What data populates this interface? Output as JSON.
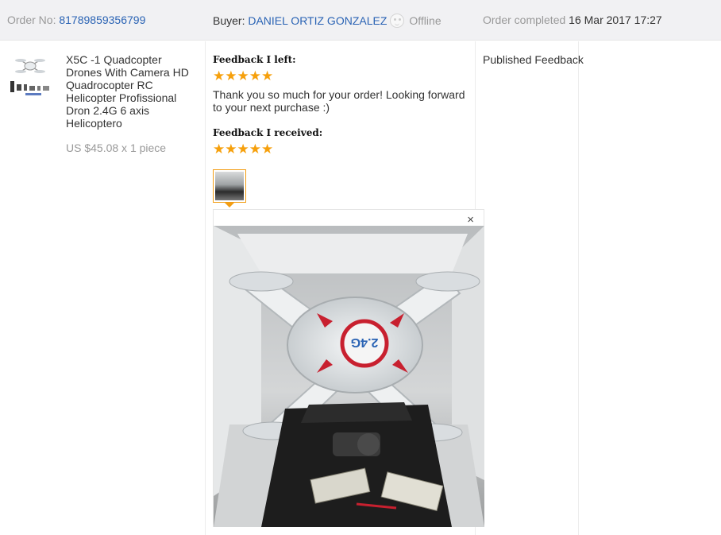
{
  "header": {
    "order_label": "Order No:",
    "order_number": "81789859356799",
    "buyer_label": "Buyer:",
    "buyer_name": "DANIEL ORTIZ GONZALEZ",
    "buyer_status": "Offline",
    "completed_label": "Order completed",
    "completed_date": "16 Mar 2017 17:27"
  },
  "product": {
    "title": "X5C -1 Quadcopter Drones With Camera HD Quadrocopter RC Helicopter Profissional Dron 2.4G 6 axis Helicoptero",
    "price": "US $45.08 x 1 piece",
    "image_icon": "drone-product-image"
  },
  "feedback": {
    "left_label": "Feedback I left:",
    "left_rating": 5,
    "left_stars": "★★★★★",
    "left_text": "Thank you so much for your order! Looking forward to your next purchase :)",
    "received_label": "Feedback I received:",
    "received_rating": 5,
    "received_stars": "★★★★★",
    "close_symbol": "×",
    "photo_label": "2.4G"
  },
  "status": {
    "text": "Published Feedback"
  },
  "colors": {
    "link": "#2a63b4",
    "star": "#f6a00c",
    "photo_border": "#f29d13",
    "header_bg": "#f1f1f3"
  }
}
